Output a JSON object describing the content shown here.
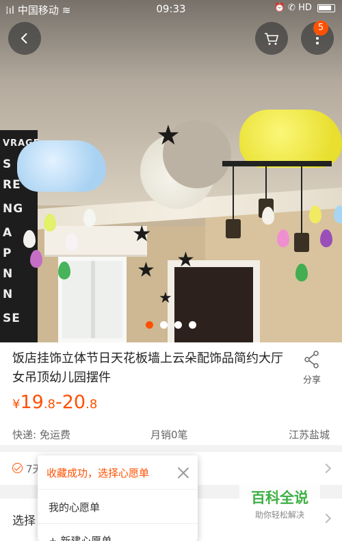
{
  "status_bar": {
    "carrier": "中国移动",
    "time": "09:33",
    "network": "HD"
  },
  "header": {
    "cart_badge": "5"
  },
  "gallery": {
    "image_count": 4,
    "active_index": 0,
    "poster_letters": [
      "VRAGE",
      "S",
      "RE",
      "NG",
      "A",
      "P",
      "N",
      "N",
      "SE"
    ]
  },
  "product": {
    "title": "饭店挂饰立体节日天花板墙上云朵配饰品简约大厅女吊顶幼儿园摆件",
    "share_label": "分享",
    "price": {
      "currency": "¥",
      "low_int": "19",
      "low_dec": ".8",
      "sep": "-",
      "high_int": "20",
      "high_dec": ".8"
    },
    "shipping": "快递: 免运费",
    "monthly_sales": "月销0笔",
    "location": "江苏盐城",
    "accent_color": "#ff5000"
  },
  "rows": {
    "service_text": "7天",
    "select_text": "选择"
  },
  "wishlist_popup": {
    "message": "收藏成功，选择心愿单",
    "items": [
      "我的心愿单",
      "+ 新建心愿单"
    ]
  },
  "watermark": {
    "main": "百科全说",
    "sub": "助你轻松解决"
  }
}
